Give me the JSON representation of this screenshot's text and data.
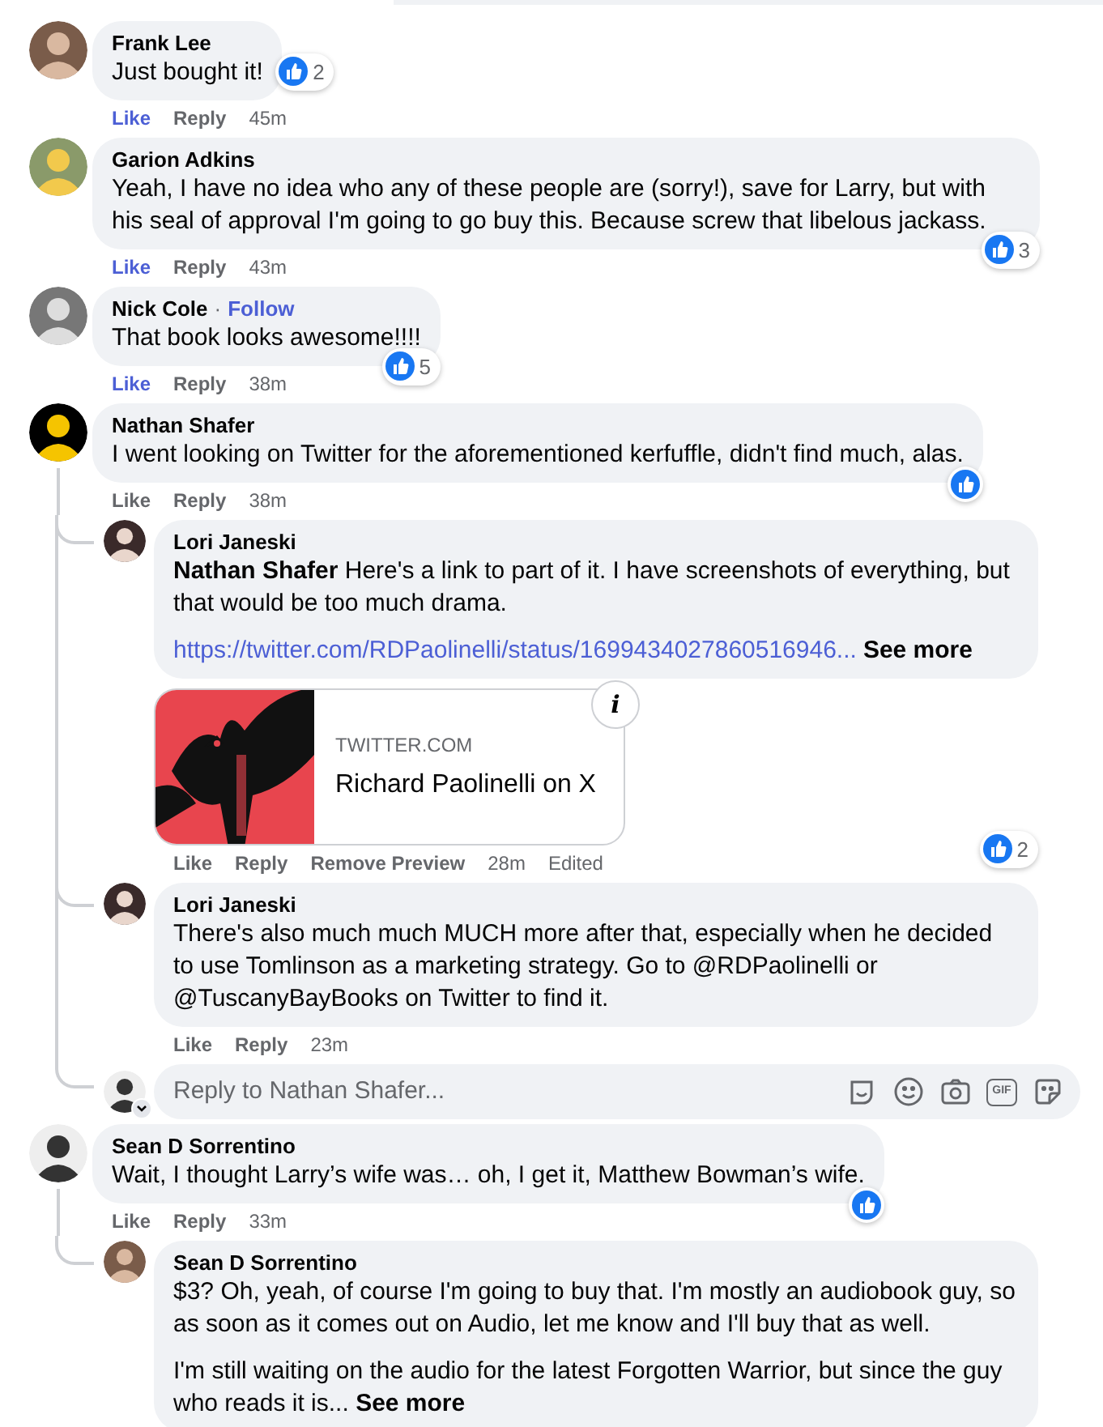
{
  "comments": [
    {
      "author": "Frank Lee",
      "paragraphs": [
        "Just bought it!"
      ],
      "reaction": true,
      "reactions": "2",
      "liked": true,
      "actions": [
        "Like",
        "Reply"
      ],
      "time": "45m"
    },
    {
      "author": "Garion Adkins",
      "paragraphs": [
        "Yeah, I have no idea who any of these people are (sorry!), save for Larry, but with his seal of approval I'm going to go buy this. Because screw that libelous jackass."
      ],
      "reaction": true,
      "reactions": "3",
      "liked": true,
      "actions": [
        "Like",
        "Reply"
      ],
      "time": "43m"
    },
    {
      "author": "Nick Cole",
      "separator": "·",
      "follow": "Follow",
      "paragraphs": [
        "That book looks awesome!!!!"
      ],
      "reaction": true,
      "reactions": "5",
      "liked": true,
      "actions": [
        "Like",
        "Reply"
      ],
      "time": "38m"
    },
    {
      "author": "Nathan Shafer",
      "paragraphs": [
        "I went looking on Twitter for the aforementioned kerfuffle, didn't find much, alas."
      ],
      "reaction": true,
      "liked": false,
      "actions": [
        "Like",
        "Reply"
      ],
      "time": "38m",
      "replies": [
        {
          "author": "Lori Janeski",
          "paragraphs": [
            "**Nathan Shafer** Here's a link to part of it. I have screenshots of everything, but that would be too much drama."
          ],
          "link": "https://twitter.com/RDPaolinelli/status/1699434027860516946...",
          "see_more": "See more",
          "preview": {
            "kind": "picture",
            "info": "i",
            "domain": "TWITTER.COM",
            "title": "Richard Paolinelli on X"
          },
          "reaction": true,
          "reactions": "2",
          "liked": false,
          "actions": [
            "Like",
            "Reply",
            "Remove Preview"
          ],
          "time": "28m",
          "edited": "Edited"
        },
        {
          "author": "Lori Janeski",
          "paragraphs": [
            "There's also much much MUCH more after that, especially when he decided to use Tomlinson as a marketing strategy. Go to @RDPaolinelli or @TuscanyBayBooks on Twitter to find it."
          ],
          "liked": false,
          "actions": [
            "Like",
            "Reply"
          ],
          "time": "23m"
        }
      ],
      "reply_box": {
        "placeholder": "Reply to Nathan Shafer...",
        "gif": "GIF"
      }
    },
    {
      "author": "Sean D Sorrentino",
      "paragraphs": [
        "Wait, I thought Larry’s wife was… oh, I get it, Matthew Bowman’s wife."
      ],
      "reaction": true,
      "liked": false,
      "actions": [
        "Like",
        "Reply"
      ],
      "time": "33m",
      "replies": [
        {
          "author": "Sean D Sorrentino",
          "paragraphs": [
            "$3? Oh, yeah, of course I'm going to buy that. I'm mostly an audiobook guy, so as soon as it comes out on Audio, let me know and I'll buy that as well.",
            "I'm still waiting on the audio for the latest Forgotten Warrior, but since the guy who reads it is..."
          ],
          "see_more": "See more"
        }
      ]
    }
  ]
}
